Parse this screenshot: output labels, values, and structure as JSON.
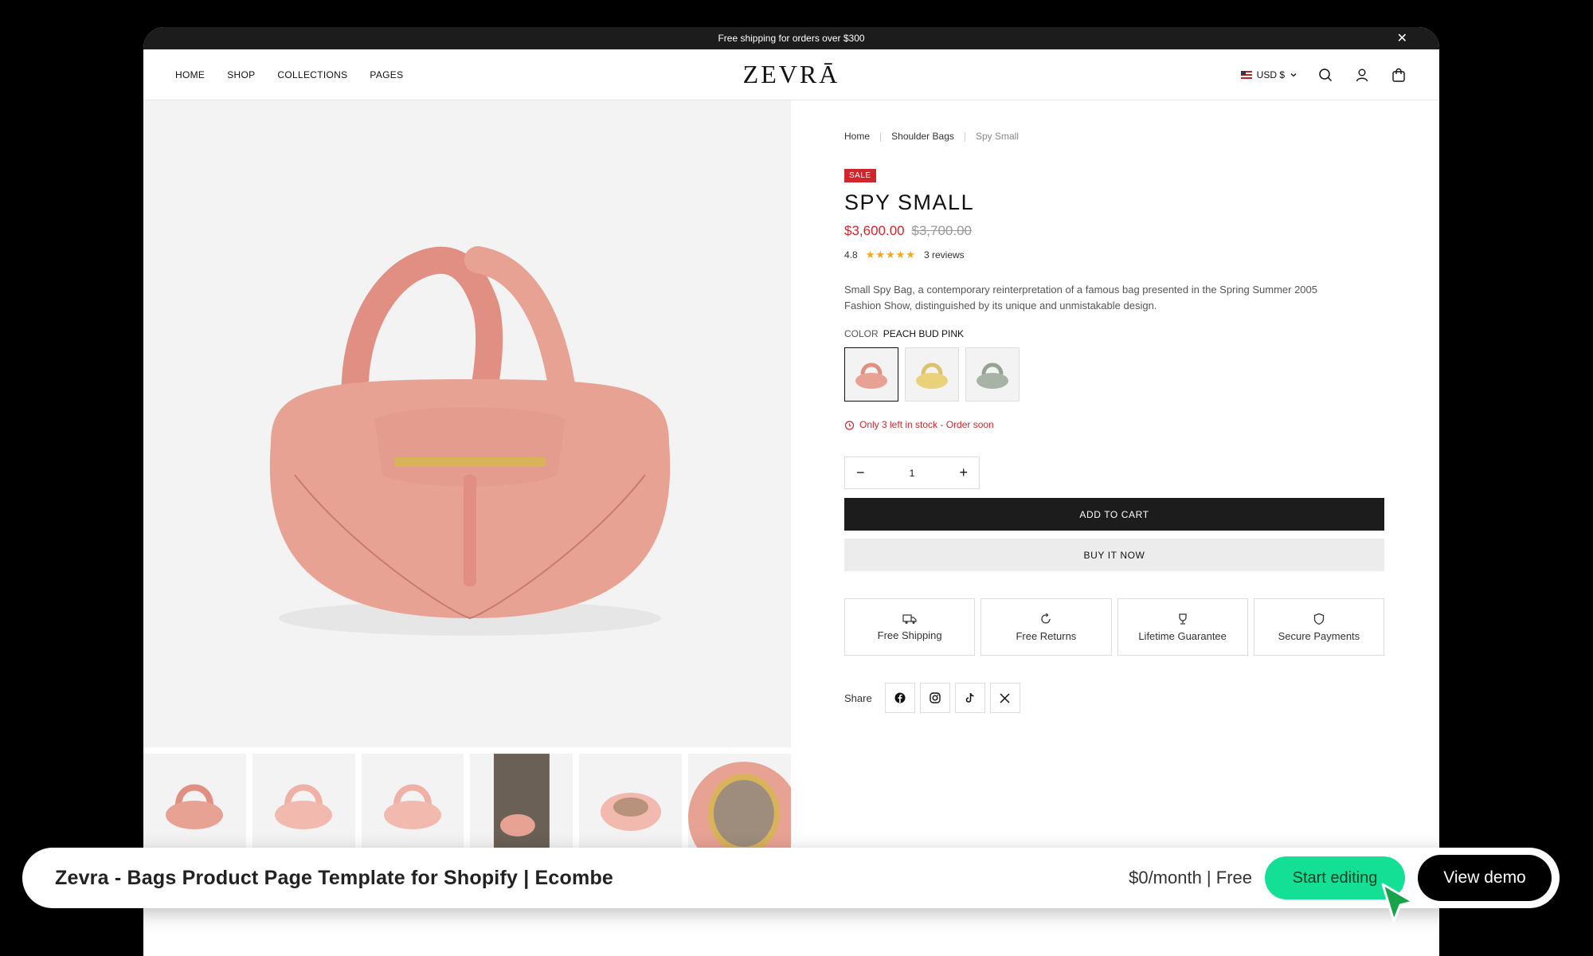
{
  "announcement": {
    "text": "Free shipping for orders over $300"
  },
  "nav": {
    "items": [
      "HOME",
      "SHOP",
      "COLLECTIONS",
      "PAGES"
    ]
  },
  "logo": "ZEVRĀ",
  "currency": "USD $",
  "breadcrumb": {
    "home": "Home",
    "category": "Shoulder Bags",
    "current": "Spy Small"
  },
  "product": {
    "badge": "SALE",
    "title": "SPY SMALL",
    "price": "$3,600.00",
    "compare_price": "$3,700.00",
    "rating": "4.8",
    "rating_value": 4.8,
    "reviews": "3 reviews",
    "description": "Small Spy Bag, a contemporary reinterpretation of a famous bag presented in the Spring Summer 2005 Fashion Show, distinguished by its unique and unmistakable design.",
    "color_label": "COLOR",
    "color_value": "PEACH BUD PINK",
    "swatch_colors": [
      "#e8a294",
      "#e9d27a",
      "#a7b3a4"
    ],
    "stock": "Only 3 left in stock - Order soon",
    "quantity": "1",
    "add_to_cart": "ADD TO CART",
    "buy_now": "BUY IT NOW"
  },
  "features": [
    "Free Shipping",
    "Free Returns",
    "Lifetime Guarantee",
    "Secure Payments"
  ],
  "share": {
    "label": "Share"
  },
  "colors": {
    "accent": "#d0252b",
    "bag": "#e8a294",
    "cta": "#13e095"
  },
  "bottom_bar": {
    "title": "Zevra - Bags Product Page Template for Shopify | Ecombe",
    "price": "$0/month | Free",
    "start": "Start editing",
    "demo": "View demo"
  }
}
